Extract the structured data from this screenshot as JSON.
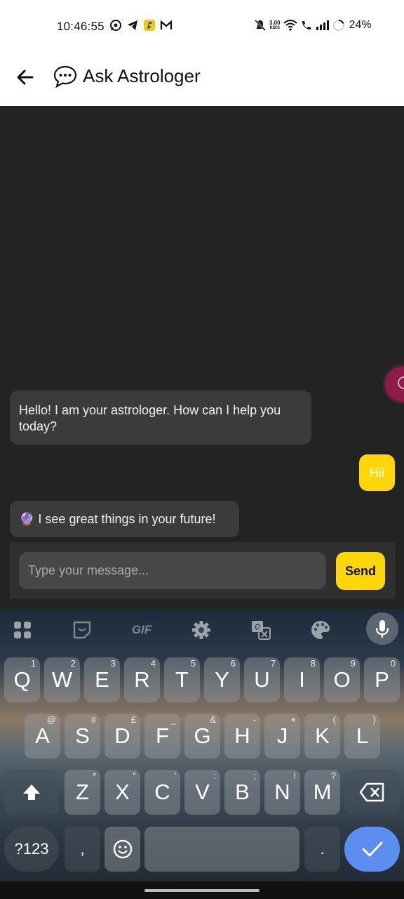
{
  "status_bar": {
    "time": "10:46:55",
    "net_speed_value": "3.00",
    "net_speed_unit": "KB/S",
    "battery": "24%",
    "left_icons": [
      "whatsapp-icon",
      "telegram-icon",
      "flipkart-icon",
      "gmail-icon"
    ],
    "right_icons": [
      "mute-icon",
      "wifi-icon",
      "call-icon",
      "signal-icon",
      "battery-icon"
    ]
  },
  "app_bar": {
    "title": "Ask Astrologer",
    "title_icon": "speech-bubble-icon",
    "back_icon": "back-arrow-icon"
  },
  "messages": [
    {
      "sender": "bot",
      "text": "Hello! I am your astrologer. How can I help you today?"
    },
    {
      "sender": "user",
      "text": "Hii"
    },
    {
      "sender": "bot",
      "text": "🔮 I see great things in your future!"
    }
  ],
  "composer": {
    "placeholder": "Type your message...",
    "value": "",
    "send_label": "Send"
  },
  "keyboard": {
    "toolbar": [
      "apps-grid-icon",
      "sticker-icon",
      "gif-icon",
      "settings-gear-icon",
      "translate-icon",
      "palette-icon",
      "mic-icon"
    ],
    "gif_label": "GIF",
    "rows": [
      [
        {
          "k": "Q",
          "s": "1"
        },
        {
          "k": "W",
          "s": "2"
        },
        {
          "k": "E",
          "s": "3"
        },
        {
          "k": "R",
          "s": "4"
        },
        {
          "k": "T",
          "s": "5"
        },
        {
          "k": "Y",
          "s": "6"
        },
        {
          "k": "U",
          "s": "7"
        },
        {
          "k": "I",
          "s": "8"
        },
        {
          "k": "O",
          "s": "9"
        },
        {
          "k": "P",
          "s": "0"
        }
      ],
      [
        {
          "k": "A",
          "s": "@"
        },
        {
          "k": "S",
          "s": "#"
        },
        {
          "k": "D",
          "s": "£"
        },
        {
          "k": "F",
          "s": "_"
        },
        {
          "k": "G",
          "s": "&"
        },
        {
          "k": "H",
          "s": "-"
        },
        {
          "k": "J",
          "s": "+"
        },
        {
          "k": "K",
          "s": "("
        },
        {
          "k": "L",
          "s": ")"
        }
      ],
      [
        {
          "k": "Z",
          "s": "*"
        },
        {
          "k": "X",
          "s": "\""
        },
        {
          "k": "C",
          "s": "'"
        },
        {
          "k": "V",
          "s": ":"
        },
        {
          "k": "B",
          "s": ";"
        },
        {
          "k": "N",
          "s": "!"
        },
        {
          "k": "M",
          "s": "?"
        }
      ]
    ],
    "symbols_label": "?123",
    "comma_label": ",",
    "period_label": ".",
    "shift_icon": "shift-icon",
    "backspace_icon": "backspace-icon",
    "emoji_icon": "emoji-icon",
    "enter_icon": "checkmark-icon"
  }
}
